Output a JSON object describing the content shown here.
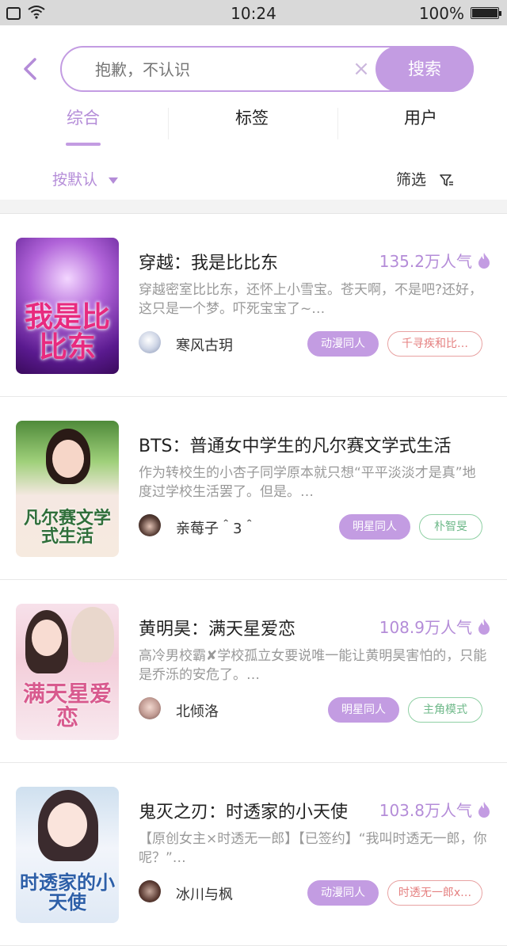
{
  "status_bar": {
    "time": "10:24",
    "battery": "100%"
  },
  "search": {
    "placeholder": "抱歉，不认识",
    "clear": "×",
    "button": "搜索"
  },
  "tabs": [
    {
      "label": "综合",
      "active": true
    },
    {
      "label": "标签",
      "active": false
    },
    {
      "label": "用户",
      "active": false
    }
  ],
  "sort": {
    "label": "按默认"
  },
  "filter": {
    "label": "筛选"
  },
  "accent_color": "#c39ce2",
  "results": [
    {
      "title": "穿越：我是比比东",
      "popularity": "135.2万人气",
      "description": "穿越密室比比东，还怀上小雪宝。苍天啊，不是吧?还好，这只是一个梦。吓死宝宝了~…",
      "author": "寒风古玥",
      "cover_text": "我是比比东",
      "tags": [
        {
          "label": "动漫同人",
          "style": "primary"
        },
        {
          "label": "千寻疾和比…",
          "style": "outline-pink"
        }
      ]
    },
    {
      "title": "BTS：普通女中学生的凡尔赛文学式生活",
      "popularity": "",
      "description": "作为转校生的小杏子同学原本就只想“平平淡淡才是真”地度过学校生活罢了。但是。…",
      "author": "亲莓子＾3＾",
      "cover_text": "凡尔赛文学式生活",
      "tags": [
        {
          "label": "明星同人",
          "style": "primary"
        },
        {
          "label": "朴智旻",
          "style": "outline-green"
        }
      ]
    },
    {
      "title": "黄明昊：满天星爱恋",
      "popularity": "108.9万人气",
      "description": "高冷男校霸✘学校孤立女要说唯一能让黄明昊害怕的，只能是乔泺的安危了。…",
      "author": "北倾洛",
      "cover_text": "满天星爱恋",
      "tags": [
        {
          "label": "明星同人",
          "style": "primary"
        },
        {
          "label": "主角模式",
          "style": "outline-green"
        }
      ]
    },
    {
      "title": "鬼灭之刃：时透家的小天使",
      "popularity": "103.8万人气",
      "description": "【原创女主×时透无一郎】【已签约】“我叫时透无一郎，你呢？”…",
      "author": "冰川与枫",
      "cover_text": "时透家的小天使",
      "tags": [
        {
          "label": "动漫同人",
          "style": "primary"
        },
        {
          "label": "时透无一郎x…",
          "style": "outline-pink"
        }
      ]
    }
  ]
}
